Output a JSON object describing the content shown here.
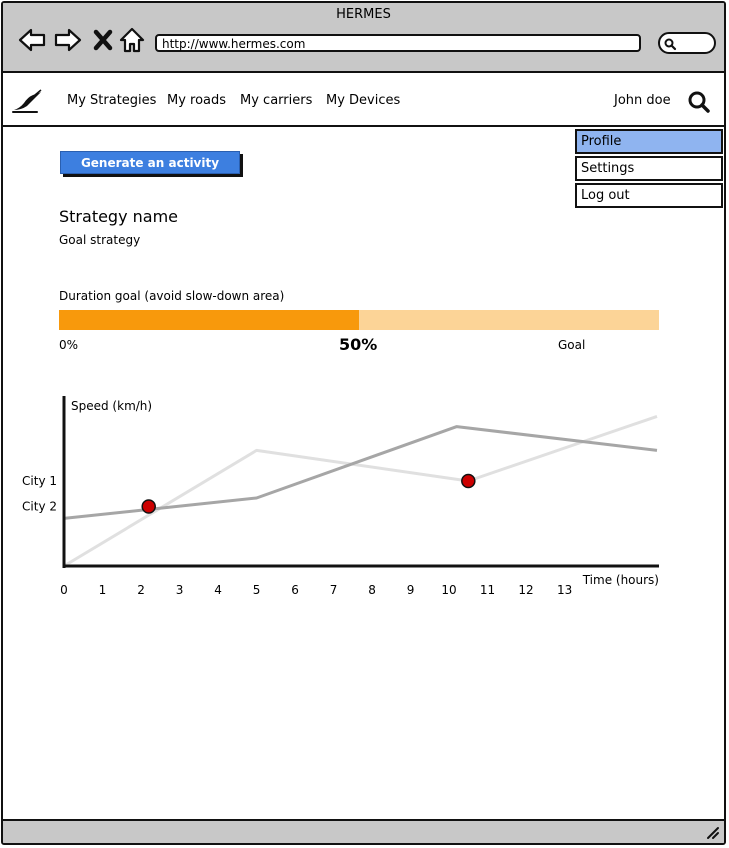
{
  "window": {
    "title": "HERMES"
  },
  "browser": {
    "url": "http://www.hermes.com"
  },
  "nav": {
    "links": [
      "My Strategies",
      "My roads",
      "My carriers",
      "My Devices"
    ],
    "user": "John doe"
  },
  "user_menu": {
    "items": [
      "Profile",
      "Settings",
      "Log out"
    ],
    "active_index": 0
  },
  "main": {
    "report_button": "Generate an activity report",
    "strategy_name": "Strategy name",
    "strategy_sub": "Goal strategy",
    "goal_label": "Duration goal (avoid slow-down area)",
    "progress": {
      "percent": 50,
      "start_label": "0%",
      "value_label": "50%",
      "end_label": "Goal"
    }
  },
  "colors": {
    "accent_button": "#3d7fe0",
    "progress_fill": "#f8990c",
    "progress_track": "#fcd497",
    "marker": "#cc0000"
  },
  "chart_data": {
    "type": "line",
    "ylabel": "Speed (km/h)",
    "xlabel": "Time (hours)",
    "x_ticks": [
      "0",
      "1",
      "2",
      "3",
      "4",
      "5",
      "6",
      "7",
      "8",
      "9",
      "10",
      "11",
      "12",
      "13"
    ],
    "x_tick_values": [
      0,
      1,
      2,
      3,
      4,
      5,
      6,
      7,
      8,
      9,
      10,
      11,
      12,
      13
    ],
    "xlim": [
      0,
      15.4
    ],
    "ylim": [
      0,
      100
    ],
    "y_tick_labels": [
      {
        "label": "City 1",
        "value": 50
      },
      {
        "label": "City 2",
        "value": 35
      }
    ],
    "series": [
      {
        "color": "#e0e0e0",
        "x": [
          0,
          5,
          10.5,
          15.4
        ],
        "y": [
          0,
          68,
          50,
          88
        ]
      },
      {
        "color": "#a6a6a6",
        "x": [
          0,
          5,
          10.2,
          15.4
        ],
        "y": [
          28,
          40,
          82,
          68
        ]
      }
    ],
    "markers": [
      {
        "x": 2.2,
        "y": 35
      },
      {
        "x": 10.5,
        "y": 50
      }
    ]
  }
}
